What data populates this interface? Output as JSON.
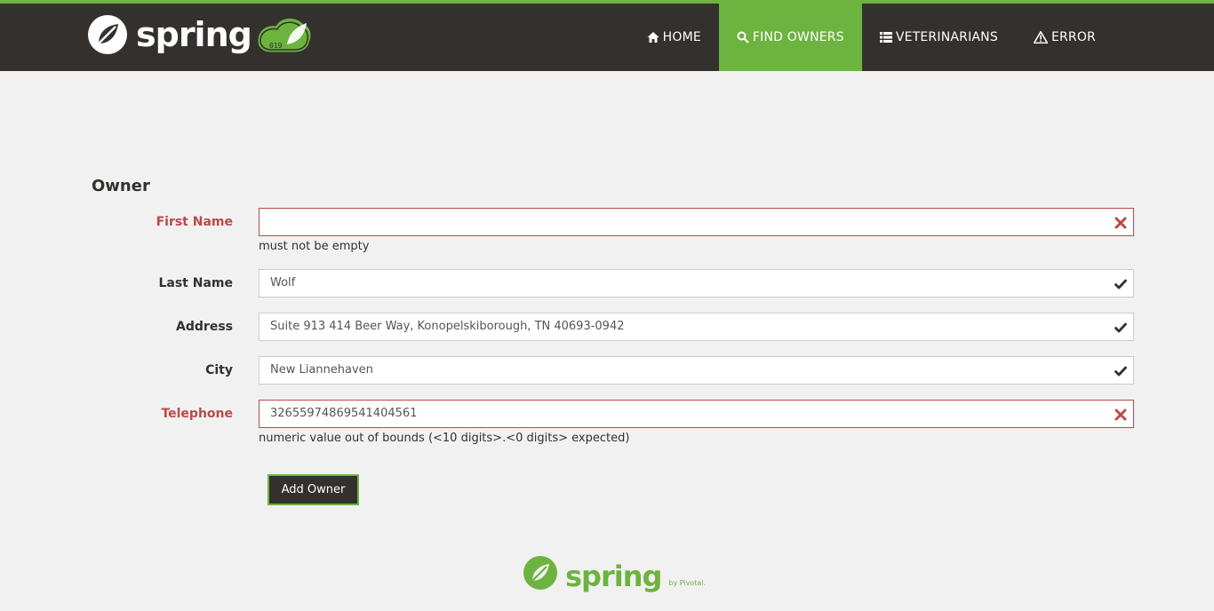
{
  "brand": {
    "name": "spring",
    "badge_text": "019"
  },
  "nav": [
    {
      "label": "Home",
      "icon": "home-icon"
    },
    {
      "label": "Find owners",
      "icon": "search-icon",
      "active": true
    },
    {
      "label": "Veterinarians",
      "icon": "list-icon"
    },
    {
      "label": "Error",
      "icon": "warning-icon"
    }
  ],
  "form": {
    "heading": "Owner",
    "fields": {
      "first_name": {
        "label": "First Name",
        "value": "",
        "status": "error",
        "help": "must not be empty"
      },
      "last_name": {
        "label": "Last Name",
        "value": "Wolf",
        "status": "ok"
      },
      "address": {
        "label": "Address",
        "value": "Suite 913 414 Beer Way, Konopelskiborough, TN 40693-0942",
        "status": "ok"
      },
      "city": {
        "label": "City",
        "value": "New Liannehaven",
        "status": "ok"
      },
      "telephone": {
        "label": "Telephone",
        "value": "32655974869541404561",
        "status": "error",
        "help": "numeric value out of bounds (<10 digits>.<0 digits> expected)"
      }
    },
    "submit_label": "Add Owner"
  },
  "footer": {
    "brand": "spring",
    "by": "by Pivotal."
  },
  "colors": {
    "accent": "#6db33f",
    "dark": "#34302d",
    "error": "#b94a48",
    "background": "#f1f1f1"
  }
}
